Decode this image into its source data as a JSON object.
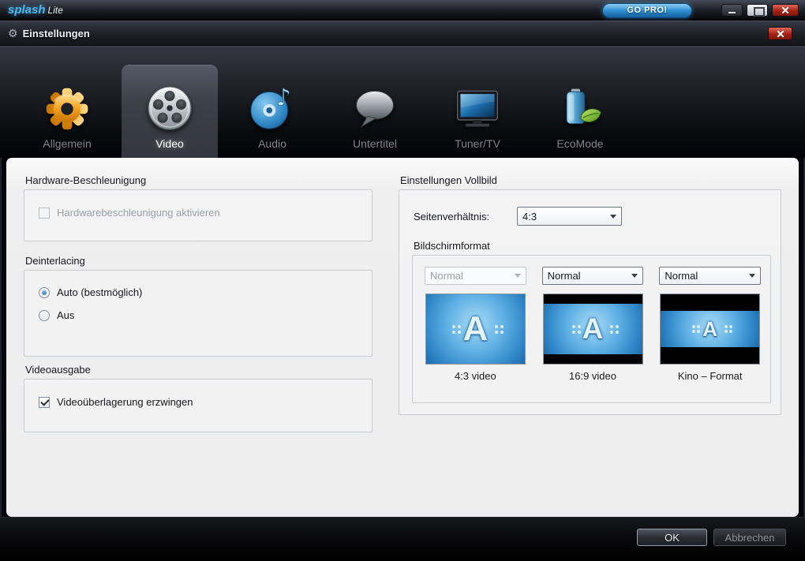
{
  "colors": {
    "gopro_blue": "#2e8fd0",
    "close_red": "#a32115",
    "content_bg": "#ededed",
    "selection_blue": "#2f6da6"
  },
  "titlebar": {
    "logo_main": "splash",
    "logo_suffix": "Lite",
    "go_pro_label": "GO PRO!"
  },
  "dialog": {
    "title": "Einstellungen",
    "gear_glyph": "⚙"
  },
  "tabs": [
    {
      "label": "Allgemein",
      "icon": "gear-icon",
      "selected": false
    },
    {
      "label": "Video",
      "icon": "film-reel-icon",
      "selected": true
    },
    {
      "label": "Audio",
      "icon": "audio-disc-icon",
      "selected": false
    },
    {
      "label": "Untertitel",
      "icon": "speech-bubble-icon",
      "selected": false
    },
    {
      "label": "Tuner/TV",
      "icon": "tv-icon",
      "selected": false
    },
    {
      "label": "EcoMode",
      "icon": "battery-leaf-icon",
      "selected": false
    }
  ],
  "settings": {
    "hardware": {
      "group_title": "Hardware-Beschleunigung",
      "checkbox_label": "Hardwarebeschleunigung aktivieren",
      "checked": false,
      "enabled": false
    },
    "deinterlacing": {
      "group_title": "Deinterlacing",
      "option_auto": "Auto (bestmöglich)",
      "option_aus": "Aus",
      "selected_option": "Auto (bestmöglich)"
    },
    "videoausgabe": {
      "group_title": "Videoausgabe",
      "checkbox_label": "Videoüberlagerung erzwingen",
      "checked": true
    },
    "vollbild": {
      "group_title": "Einstellungen Vollbild",
      "aspect_label": "Seitenverhältnis:",
      "aspect_value": "4:3",
      "bildschirmformat": {
        "group_title": "Bildschirmformat",
        "preview_letter": "A",
        "items": [
          {
            "dropdown_value": "Normal",
            "enabled": false,
            "caption": "4:3 video"
          },
          {
            "dropdown_value": "Normal",
            "enabled": true,
            "caption": "16:9 video"
          },
          {
            "dropdown_value": "Normal",
            "enabled": true,
            "caption": "Kino – Format"
          }
        ]
      }
    }
  },
  "footer": {
    "ok_label": "OK",
    "cancel_label": "Abbrechen"
  }
}
